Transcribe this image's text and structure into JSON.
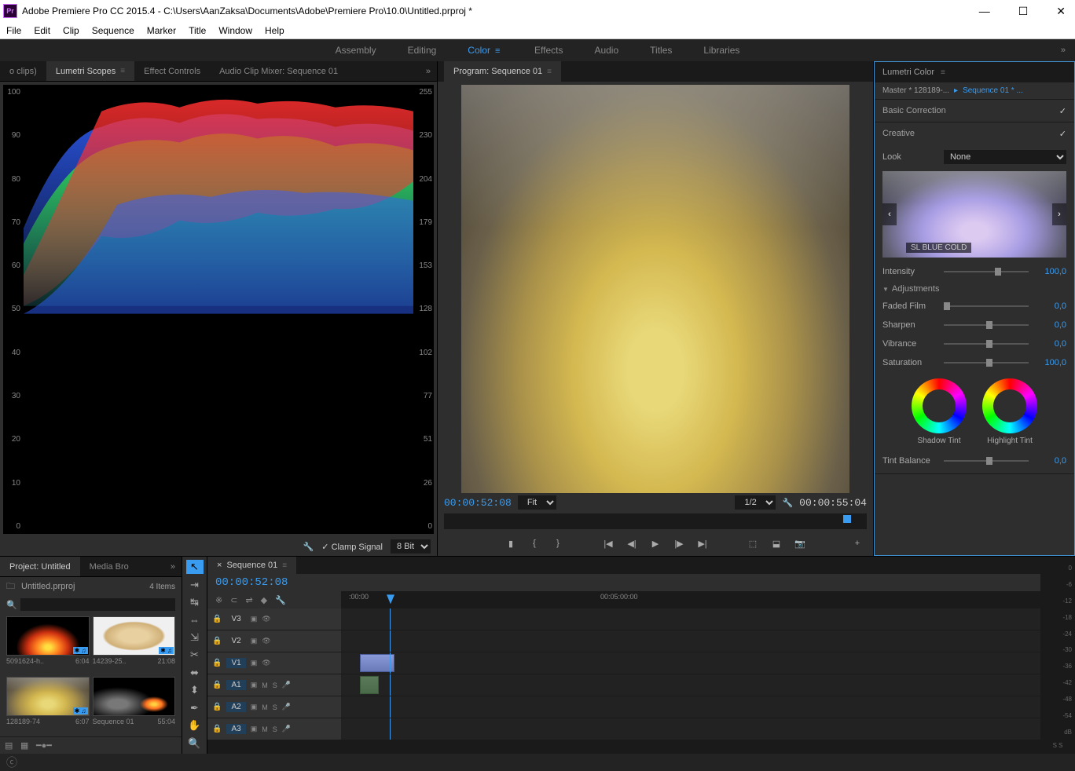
{
  "title": "Adobe Premiere Pro CC 2015.4 - C:\\Users\\AanZaksa\\Documents\\Adobe\\Premiere Pro\\10.0\\Untitled.prproj *",
  "menu": [
    "File",
    "Edit",
    "Clip",
    "Sequence",
    "Marker",
    "Title",
    "Window",
    "Help"
  ],
  "workspaces": [
    "Assembly",
    "Editing",
    "Color",
    "Effects",
    "Audio",
    "Titles",
    "Libraries"
  ],
  "active_workspace": "Color",
  "scopes": {
    "tabs_extra": "o clips)",
    "tab_active": "Lumetri Scopes",
    "tab_effect": "Effect Controls",
    "tab_mixer": "Audio Clip Mixer: Sequence 01",
    "left_axis": [
      "100",
      "90",
      "80",
      "70",
      "60",
      "50",
      "40",
      "30",
      "20",
      "10",
      "0"
    ],
    "right_axis": [
      "255",
      "230",
      "204",
      "179",
      "153",
      "128",
      "102",
      "77",
      "51",
      "26",
      "0"
    ],
    "clamp": "Clamp Signal",
    "bit": "8 Bit"
  },
  "program": {
    "title": "Program: Sequence 01",
    "timecode": "00:00:52:08",
    "fit": "Fit",
    "zoom": "1/2",
    "duration": "00:00:55:04"
  },
  "lumetri": {
    "title": "Lumetri Color",
    "master": "Master * 128189-...",
    "sequence": "Sequence 01 * ...",
    "basic": "Basic Correction",
    "creative": "Creative",
    "look": "Look",
    "look_value": "None",
    "preset": "SL BLUE COLD",
    "intensity": "Intensity",
    "intensity_val": "100,0",
    "adjustments": "Adjustments",
    "faded": "Faded Film",
    "faded_val": "0,0",
    "sharpen": "Sharpen",
    "sharpen_val": "0,0",
    "vibrance": "Vibrance",
    "vibrance_val": "0,0",
    "saturation": "Saturation",
    "saturation_val": "100,0",
    "shadow_tint": "Shadow Tint",
    "highlight_tint": "Highlight Tint",
    "tint_balance": "Tint Balance",
    "tint_balance_val": "0,0"
  },
  "project": {
    "tab": "Project: Untitled",
    "tab2": "Media Bro",
    "file": "Untitled.prproj",
    "count": "4 Items",
    "items": [
      {
        "name": "5091624-h..",
        "dur": "6:04"
      },
      {
        "name": "14239-25..",
        "dur": "21:08"
      },
      {
        "name": "128189-74",
        "dur": "6:07"
      },
      {
        "name": "Sequence 01",
        "dur": "55:04"
      }
    ]
  },
  "timeline": {
    "tab": "Sequence 01",
    "timecode": "00:00:52:08",
    "ruler": [
      ":00:00",
      "00:05:00:00"
    ],
    "tracks_v": [
      "V3",
      "V2",
      "V1"
    ],
    "tracks_a": [
      "A1",
      "A2",
      "A3"
    ]
  },
  "meters": {
    "scale": [
      "0",
      "-6",
      "-12",
      "-18",
      "-24",
      "-30",
      "-36",
      "-42",
      "-48",
      "-54",
      "dB"
    ],
    "channels": [
      "S",
      "S"
    ]
  }
}
